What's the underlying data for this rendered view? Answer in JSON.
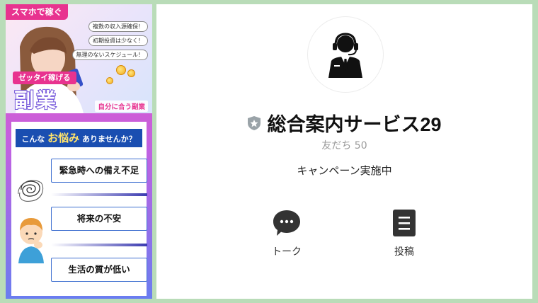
{
  "banner": {
    "tag": "スマホで稼ぐ",
    "bubbles": [
      "複数の収入源確保！",
      "初期投資は少なく！",
      "無理のないスケジュール！"
    ],
    "pill": "ゼッタイ稼げる",
    "big": "副業",
    "suit": "自分に合う副業",
    "question_prefix": "こんな",
    "question_highlight": "お悩み",
    "question_suffix": "ありませんか？",
    "worries": [
      "緊急時への備え不足",
      "将来の不安",
      "生活の質が低い"
    ]
  },
  "profile": {
    "name": "総合案内サービス29",
    "friends": "友だち 50",
    "status": "キャンペーン実施中",
    "actions": [
      {
        "label": "トーク",
        "icon": "chat-bubble-icon"
      },
      {
        "label": "投稿",
        "icon": "post-list-icon"
      }
    ]
  },
  "colors": {
    "page_bg": "#b9dcb8",
    "banner_pink": "#e8338f",
    "panel_blue": "#1a4eb1",
    "icon_dark": "#333333"
  }
}
